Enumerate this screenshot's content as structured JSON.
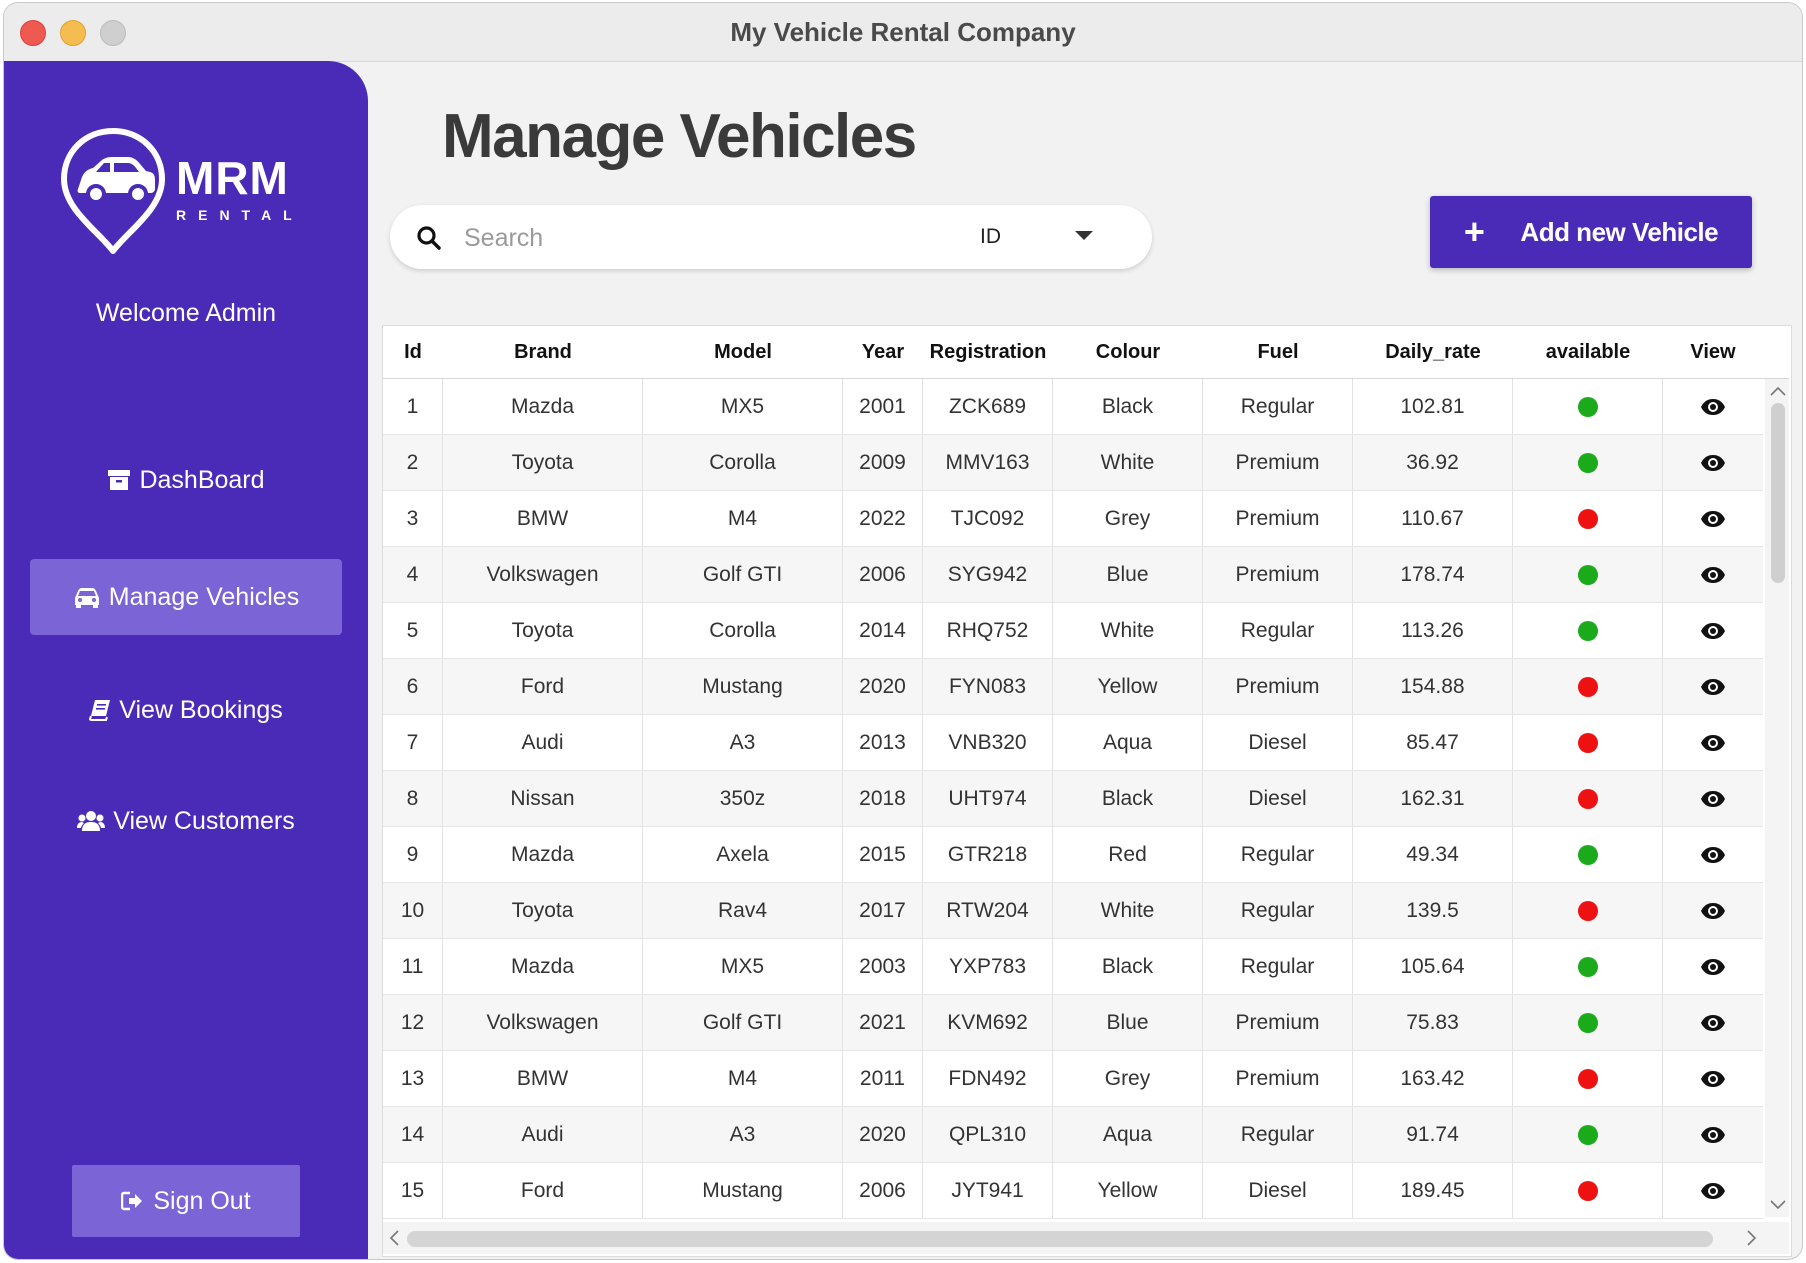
{
  "window": {
    "title": "My Vehicle Rental Company"
  },
  "sidebar": {
    "logo_main": "MRM",
    "logo_sub": "RENTAL",
    "welcome": "Welcome Admin",
    "items": [
      {
        "label": "DashBoard",
        "icon": "archive-box-icon",
        "active": false
      },
      {
        "label": "Manage Vehicles",
        "icon": "car-icon",
        "active": true
      },
      {
        "label": "View Bookings",
        "icon": "book-icon",
        "active": false
      },
      {
        "label": "View Customers",
        "icon": "users-icon",
        "active": false
      }
    ],
    "signout": "Sign Out"
  },
  "main": {
    "title": "Manage Vehicles",
    "search": {
      "placeholder": "Search",
      "filter_value": "ID"
    },
    "add_button": {
      "icon": "+",
      "label": "Add new Vehicle"
    }
  },
  "table": {
    "columns": [
      "Id",
      "Brand",
      "Model",
      "Year",
      "Registration",
      "Colour",
      "Fuel",
      "Daily_rate",
      "available",
      "View"
    ],
    "status_colors": {
      "available": "#1aaa1a",
      "unavailable": "#ee1111"
    },
    "rows": [
      [
        "1",
        "Mazda",
        "MX5",
        "2001",
        "ZCK689",
        "Black",
        "Regular",
        "102.81",
        true
      ],
      [
        "2",
        "Toyota",
        "Corolla",
        "2009",
        "MMV163",
        "White",
        "Premium",
        "36.92",
        true
      ],
      [
        "3",
        "BMW",
        "M4",
        "2022",
        "TJC092",
        "Grey",
        "Premium",
        "110.67",
        false
      ],
      [
        "4",
        "Volkswagen",
        "Golf GTI",
        "2006",
        "SYG942",
        "Blue",
        "Premium",
        "178.74",
        true
      ],
      [
        "5",
        "Toyota",
        "Corolla",
        "2014",
        "RHQ752",
        "White",
        "Regular",
        "113.26",
        true
      ],
      [
        "6",
        "Ford",
        "Mustang",
        "2020",
        "FYN083",
        "Yellow",
        "Premium",
        "154.88",
        false
      ],
      [
        "7",
        "Audi",
        "A3",
        "2013",
        "VNB320",
        "Aqua",
        "Diesel",
        "85.47",
        false
      ],
      [
        "8",
        "Nissan",
        "350z",
        "2018",
        "UHT974",
        "Black",
        "Diesel",
        "162.31",
        false
      ],
      [
        "9",
        "Mazda",
        "Axela",
        "2015",
        "GTR218",
        "Red",
        "Regular",
        "49.34",
        true
      ],
      [
        "10",
        "Toyota",
        "Rav4",
        "2017",
        "RTW204",
        "White",
        "Regular",
        "139.5",
        false
      ],
      [
        "11",
        "Mazda",
        "MX5",
        "2003",
        "YXP783",
        "Black",
        "Regular",
        "105.64",
        true
      ],
      [
        "12",
        "Volkswagen",
        "Golf GTI",
        "2021",
        "KVM692",
        "Blue",
        "Premium",
        "75.83",
        true
      ],
      [
        "13",
        "BMW",
        "M4",
        "2011",
        "FDN492",
        "Grey",
        "Premium",
        "163.42",
        false
      ],
      [
        "14",
        "Audi",
        "A3",
        "2020",
        "QPL310",
        "Aqua",
        "Regular",
        "91.74",
        true
      ],
      [
        "15",
        "Ford",
        "Mustang",
        "2006",
        "JYT941",
        "Yellow",
        "Diesel",
        "189.45",
        false
      ]
    ]
  }
}
